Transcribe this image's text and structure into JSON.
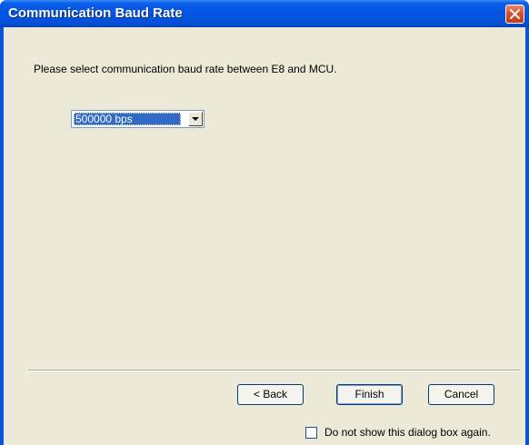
{
  "window": {
    "title": "Communication Baud Rate"
  },
  "content": {
    "instruction": "Please select communication baud rate between E8 and MCU.",
    "baud_rate_select": {
      "selected": "500000 bps"
    }
  },
  "buttons": {
    "back_label": "< Back",
    "finish_label": "Finish",
    "cancel_label": "Cancel"
  },
  "checkbox": {
    "label": "Do not show this dialog box again.",
    "checked": false
  },
  "colors": {
    "titlebar": "#0454e3",
    "selection": "#316ac5",
    "dialog_background": "#ece9d8"
  }
}
